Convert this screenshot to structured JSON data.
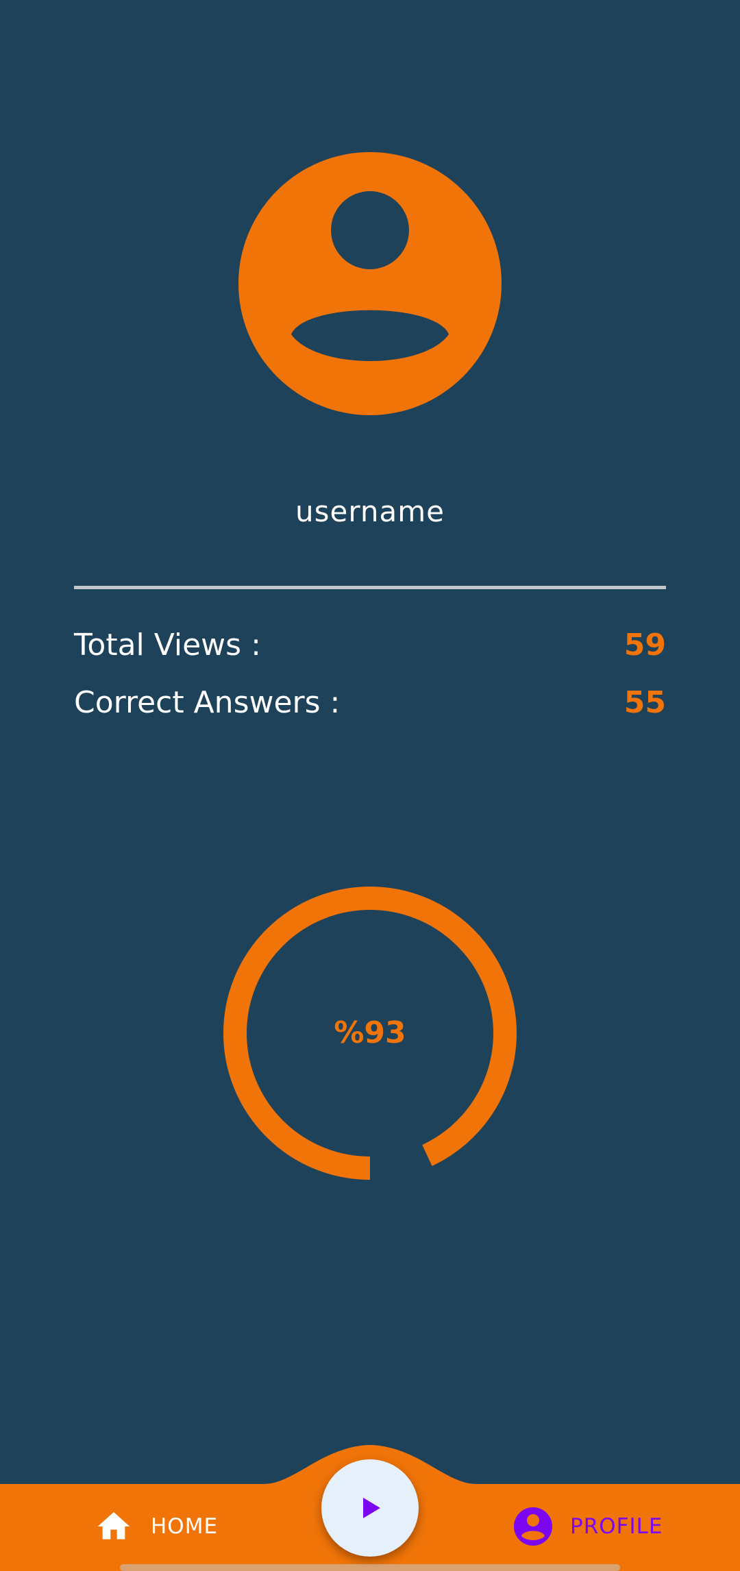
{
  "profile": {
    "username": "username"
  },
  "stats": {
    "total_views_label": "Total Views :",
    "total_views_value": "59",
    "correct_answers_label": "Correct Answers :",
    "correct_answers_value": "55"
  },
  "progress": {
    "label": "%93",
    "percent": 93
  },
  "nav": {
    "home_label": "HOME",
    "profile_label": "PROFILE",
    "play_icon": "play-icon",
    "home_icon": "home-icon",
    "profile_icon": "account-circle-icon"
  },
  "colors": {
    "background": "#1f425b",
    "accent": "#f07408",
    "active_nav": "#7b06f2",
    "fab": "#e5f0fb"
  }
}
